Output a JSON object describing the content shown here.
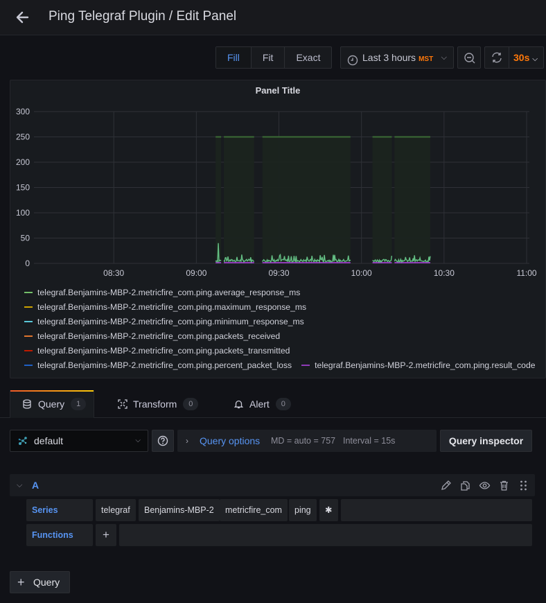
{
  "header": {
    "title": "Ping Telegraf Plugin / Edit Panel",
    "back_icon": "arrow-left-icon"
  },
  "toolbar": {
    "display_modes": [
      {
        "label": "Fill",
        "active": true
      },
      {
        "label": "Fit",
        "active": false
      },
      {
        "label": "Exact",
        "active": false
      }
    ],
    "time_range": {
      "label": "Last 3 hours",
      "timezone": "MST",
      "icon": "clock-icon"
    },
    "zoom_out_icon": "zoom-out-icon",
    "refresh_icon": "sync-icon",
    "refresh_interval": "30s"
  },
  "panel": {
    "title": "Panel Title"
  },
  "colors": {
    "accent_blue": "#5794f2",
    "accent_orange": "#ff780a"
  },
  "chart_data": {
    "type": "line",
    "title": "Panel Title",
    "xlabel": "",
    "ylabel": "",
    "ylim": [
      0,
      300
    ],
    "yticks": [
      "0",
      "50",
      "100",
      "150",
      "200",
      "250",
      "300"
    ],
    "xticks": [
      "08:30",
      "09:00",
      "09:30",
      "10:00",
      "10:30",
      "11:00"
    ],
    "x_range": [
      "08:01",
      "11:01"
    ],
    "grid": true,
    "legend_position": "bottom",
    "data_segments": [
      [
        "09:07",
        "09:09"
      ],
      [
        "09:10",
        "09:21"
      ],
      [
        "09:24",
        "09:56"
      ],
      [
        "10:04",
        "10:11"
      ],
      [
        "10:12",
        "10:25"
      ]
    ],
    "series": [
      {
        "name": "telegraf.Benjamins-MBP-2.metricfire_com.ping.average_response_ms",
        "color": "#73bf69",
        "typical_value": 4,
        "peak": 40
      },
      {
        "name": "telegraf.Benjamins-MBP-2.metricfire_com.ping.maximum_response_ms",
        "color": "#cca300",
        "typical_value": 5,
        "peak": 40
      },
      {
        "name": "telegraf.Benjamins-MBP-2.metricfire_com.ping.minimum_response_ms",
        "color": "#5ac8d8",
        "typical_value": 3,
        "peak": 38
      },
      {
        "name": "telegraf.Benjamins-MBP-2.metricfire_com.ping.packets_received",
        "color": "#e0752d",
        "typical_value": 1
      },
      {
        "name": "telegraf.Benjamins-MBP-2.metricfire_com.ping.packets_transmitted",
        "color": "#bf1b00",
        "typical_value": 1
      },
      {
        "name": "telegraf.Benjamins-MBP-2.metricfire_com.ping.percent_packet_loss",
        "color": "#1f60c4",
        "typical_value": 0
      },
      {
        "name": "telegraf.Benjamins-MBP-2.metricfire_com.ping.result_code",
        "color": "#8f3bb8",
        "typical_value": 0
      }
    ],
    "fill_series": {
      "name": "band",
      "color": "#3b6b35",
      "value": 250
    }
  },
  "tabs": [
    {
      "label": "Query",
      "count": "1",
      "icon": "database-icon",
      "active": true
    },
    {
      "label": "Transform",
      "count": "0",
      "icon": "transform-icon",
      "active": false
    },
    {
      "label": "Alert",
      "count": "0",
      "icon": "bell-icon",
      "active": false
    }
  ],
  "query_editor": {
    "datasource": "default",
    "help_icon": "question-circle-icon",
    "query_options_label": "Query options",
    "max_data_points": "MD = auto = 757",
    "interval": "Interval = 15s",
    "query_inspector_label": "Query inspector",
    "query": {
      "ref_id": "A",
      "series_label": "Series",
      "series_segments": [
        "telegraf",
        "Benjamins-MBP-2",
        "metricfire_com",
        "ping",
        "✱"
      ],
      "functions_label": "Functions",
      "add_function": "+"
    },
    "add_query_label": "Query"
  }
}
